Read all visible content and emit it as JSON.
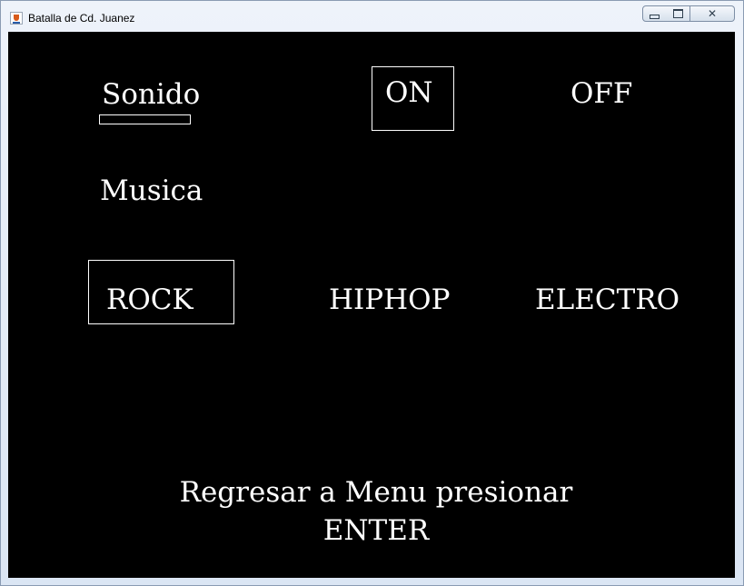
{
  "window": {
    "title": "Batalla de Cd. Juanez",
    "controls": {
      "minimize_icon": "minimize-icon",
      "maximize_icon": "maximize-icon",
      "close_icon": "close-icon",
      "close_glyph": "✕"
    }
  },
  "menu": {
    "sound_label": "Sonido",
    "sound_options": [
      "ON",
      "OFF"
    ],
    "sound_selected": "ON",
    "music_label": "Musica",
    "music_options": [
      "ROCK",
      "HIPHOP",
      "ELECTRO"
    ],
    "music_selected": "ROCK",
    "footer_line1": "Regresar a Menu presionar",
    "footer_line2": "ENTER"
  },
  "colors": {
    "background": "#000000",
    "text": "#ffffff",
    "selection_border": "#ffffff"
  }
}
